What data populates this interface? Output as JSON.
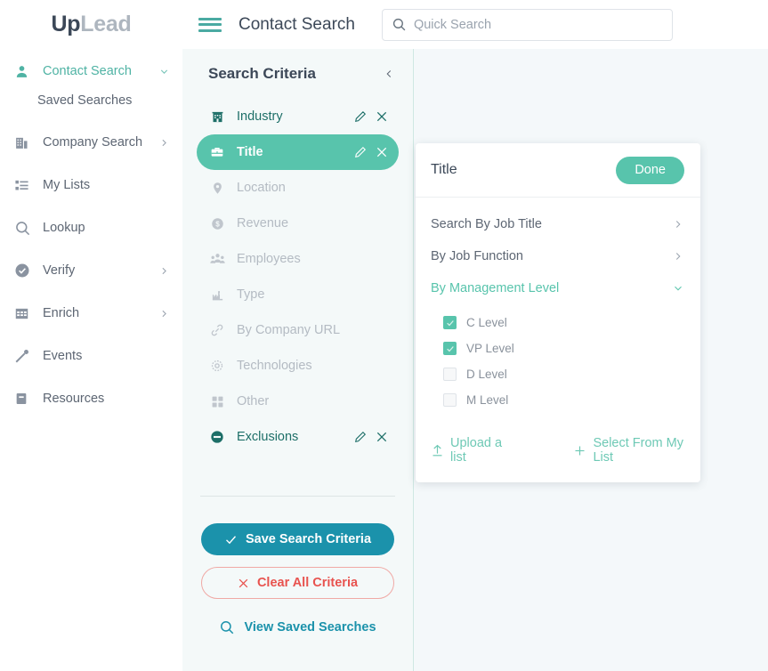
{
  "brand": {
    "up": "Up",
    "lead": "Lead",
    "accent": "#58c4ac",
    "dark_accent": "#1b92ab",
    "set_color": "#1d6f68"
  },
  "sidebar": {
    "items": [
      {
        "label": "Contact Search",
        "icon": "user-icon",
        "active": true,
        "caret": "chevron-down",
        "sub": "Saved Searches"
      },
      {
        "label": "Company Search",
        "icon": "building-icon",
        "active": false,
        "caret": "chevron-right"
      },
      {
        "label": "My Lists",
        "icon": "list-icon",
        "active": false,
        "caret": ""
      },
      {
        "label": "Lookup",
        "icon": "search-icon",
        "active": false,
        "caret": ""
      },
      {
        "label": "Verify",
        "icon": "check-circle-icon",
        "active": false,
        "caret": "chevron-right"
      },
      {
        "label": "Enrich",
        "icon": "grid-table-icon",
        "active": false,
        "caret": "chevron-right"
      },
      {
        "label": "Events",
        "icon": "microphone-icon",
        "active": false,
        "caret": ""
      },
      {
        "label": "Resources",
        "icon": "book-icon",
        "active": false,
        "caret": ""
      }
    ]
  },
  "topbar": {
    "menu_icon": "hamburger-icon",
    "title": "Contact Search",
    "search": {
      "icon": "search-icon",
      "placeholder": "Quick Search",
      "value": ""
    }
  },
  "criteria": {
    "heading": "Search Criteria",
    "collapse_icon": "chevron-left-icon",
    "rows": [
      {
        "label": "Industry",
        "icon": "building-icon",
        "state": "set",
        "edit": "pencil-icon",
        "remove": "close-icon"
      },
      {
        "label": "Title",
        "icon": "briefcase-icon",
        "state": "selected",
        "edit": "pencil-icon",
        "remove": "close-icon"
      },
      {
        "label": "Location",
        "icon": "map-pin-icon",
        "state": "dim"
      },
      {
        "label": "Revenue",
        "icon": "dollar-circle-icon",
        "state": "dim"
      },
      {
        "label": "Employees",
        "icon": "people-icon",
        "state": "dim"
      },
      {
        "label": "Type",
        "icon": "factory-icon",
        "state": "dim"
      },
      {
        "label": "By Company URL",
        "icon": "link-icon",
        "state": "dim"
      },
      {
        "label": "Technologies",
        "icon": "gear-icon",
        "state": "dim"
      },
      {
        "label": "Other",
        "icon": "squares-icon",
        "state": "dim"
      },
      {
        "label": "Exclusions",
        "icon": "no-entry-icon",
        "state": "set",
        "edit": "pencil-icon",
        "remove": "close-icon"
      }
    ],
    "save_label": "Save Search Criteria",
    "clear_label": "Clear All Criteria",
    "view_label": "View Saved Searches"
  },
  "title_popup": {
    "heading": "Title",
    "done_label": "Done",
    "sections": [
      {
        "label": "Search By Job Title",
        "open": false,
        "caret": "chevron-right-icon"
      },
      {
        "label": "By Job Function",
        "open": false,
        "caret": "chevron-right-icon"
      },
      {
        "label": "By Management Level",
        "open": true,
        "caret": "chevron-down-icon"
      }
    ],
    "management_levels": [
      {
        "label": "C Level",
        "checked": true
      },
      {
        "label": "VP Level",
        "checked": true
      },
      {
        "label": "D Level",
        "checked": false
      },
      {
        "label": "M Level",
        "checked": false
      }
    ],
    "upload_label": "Upload a list",
    "upload_icon": "upload-icon",
    "select_list_label": "Select From My List",
    "select_list_icon": "plus-icon"
  }
}
